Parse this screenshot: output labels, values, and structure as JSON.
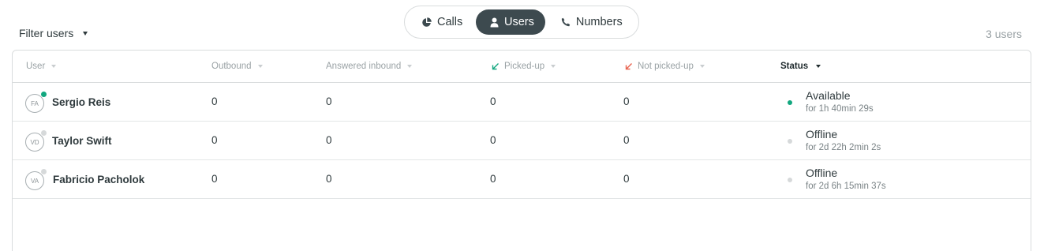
{
  "filter": {
    "label": "Filter users"
  },
  "tabs": [
    {
      "label": "Calls",
      "icon": "pie-chart-icon",
      "active": false
    },
    {
      "label": "Users",
      "icon": "user-icon",
      "active": true
    },
    {
      "label": "Numbers",
      "icon": "phone-icon",
      "active": false
    }
  ],
  "count": "3 users",
  "table": {
    "columns": [
      "User",
      "Outbound",
      "Answered inbound",
      "Picked-up",
      "Not picked-up",
      "Status"
    ],
    "rows": [
      {
        "initials": "FA",
        "name": "Sergio Reis",
        "presence": "online",
        "outbound": "0",
        "answered": "0",
        "picked": "0",
        "not_picked": "0",
        "status": "Available",
        "duration": "for 1h 40min 29s"
      },
      {
        "initials": "VD",
        "name": "Taylor Swift",
        "presence": "offline",
        "outbound": "0",
        "answered": "0",
        "picked": "0",
        "not_picked": "0",
        "status": "Offline",
        "duration": "for 2d 22h 2min 2s"
      },
      {
        "initials": "VA",
        "name": "Fabricio Pacholok",
        "presence": "offline",
        "outbound": "0",
        "answered": "0",
        "picked": "0",
        "not_picked": "0",
        "status": "Offline",
        "duration": "for 2d 6h 15min 37s"
      }
    ]
  },
  "colors": {
    "online": "#12a77f",
    "offline": "#d6d9da",
    "picked_arrow": "#12a77f",
    "not_picked_arrow": "#e8634f",
    "active_tab": "#3d4a4f"
  }
}
